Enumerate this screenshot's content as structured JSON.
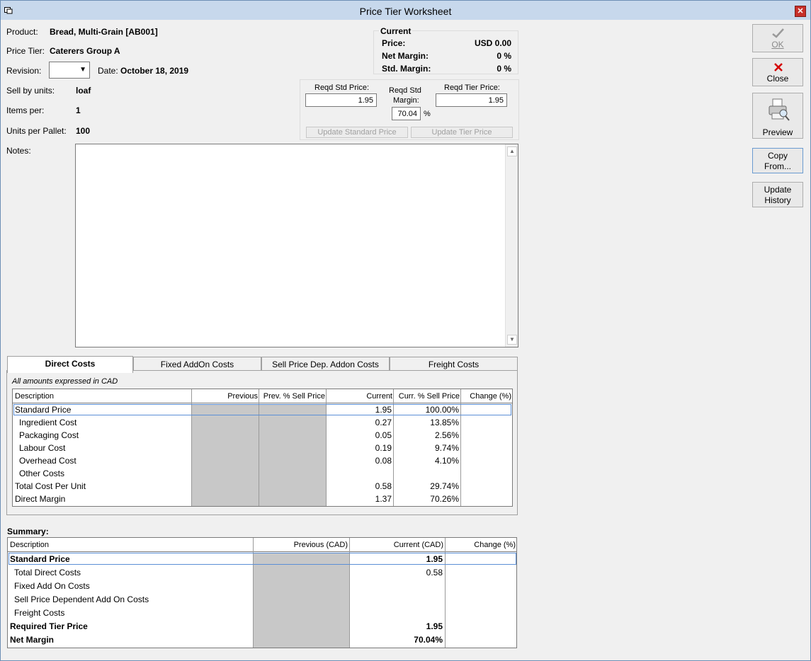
{
  "window": {
    "title": "Price Tier Worksheet",
    "close_glyph": "✕"
  },
  "product": {
    "product_label": "Product:",
    "product_value": "Bread, Multi-Grain [AB001]",
    "tier_label": "Price Tier:",
    "tier_value": "Caterers Group A",
    "revision_label": "Revision:",
    "revision_value": "",
    "date_label": "Date:",
    "date_value": "October 18, 2019",
    "sell_units_label": "Sell by units:",
    "sell_units_value": "loaf",
    "items_per_label": "Items per:",
    "items_per_value": "1",
    "units_pallet_label": "Units per Pallet:",
    "units_pallet_value": "100",
    "notes_label": "Notes:",
    "notes_value": ""
  },
  "current": {
    "title": "Current",
    "price_label": "Price:",
    "price_value": "USD 0.00",
    "net_margin_label": "Net Margin:",
    "net_margin_value": "0 %",
    "std_margin_label": "Std. Margin:",
    "std_margin_value": "0 %"
  },
  "required": {
    "std_price_label": "Reqd Std Price:",
    "std_price_value": "1.95",
    "std_margin_label_1": "Reqd Std",
    "std_margin_label_2": "Margin:",
    "std_margin_value": "70.04",
    "percent": "%",
    "tier_price_label": "Reqd Tier Price:",
    "tier_price_value": "1.95",
    "update_std_btn": "Update Standard Price",
    "update_tier_btn": "Update Tier Price"
  },
  "buttons": {
    "ok": "OK",
    "close": "Close",
    "preview": "Preview",
    "copy_1": "Copy",
    "copy_2": "From...",
    "history_1": "Update",
    "history_2": "History"
  },
  "tabs": [
    "Direct Costs",
    "Fixed AddOn Costs",
    "Sell Price Dep. Addon Costs",
    "Freight Costs"
  ],
  "direct_costs": {
    "note": "All amounts expressed in CAD",
    "headers": [
      "Description",
      "Previous",
      "Prev. % Sell Price",
      "Current",
      "Curr. % Sell Price",
      "Change (%)"
    ],
    "rows": [
      [
        "Standard Price",
        "",
        "",
        "1.95",
        "100.00%",
        ""
      ],
      [
        "Ingredient Cost",
        "",
        "",
        "0.27",
        "13.85%",
        ""
      ],
      [
        "Packaging Cost",
        "",
        "",
        "0.05",
        "2.56%",
        ""
      ],
      [
        "Labour Cost",
        "",
        "",
        "0.19",
        "9.74%",
        ""
      ],
      [
        "Overhead Cost",
        "",
        "",
        "0.08",
        "4.10%",
        ""
      ],
      [
        "Other Costs",
        "",
        "",
        "",
        "",
        ""
      ],
      [
        "Total Cost Per Unit",
        "",
        "",
        "0.58",
        "29.74%",
        ""
      ],
      [
        "Direct Margin",
        "",
        "",
        "1.37",
        "70.26%",
        ""
      ]
    ]
  },
  "summary": {
    "title": "Summary:",
    "headers": [
      "Description",
      "Previous (CAD)",
      "Current (CAD)",
      "Change (%)"
    ],
    "rows": [
      [
        "Standard Price",
        "",
        "1.95",
        ""
      ],
      [
        "Total Direct Costs",
        "",
        "0.58",
        ""
      ],
      [
        "Fixed Add On Costs",
        "",
        "",
        ""
      ],
      [
        "Sell Price Dependent Add On Costs",
        "",
        "",
        ""
      ],
      [
        "Freight Costs",
        "",
        "",
        ""
      ],
      [
        "Required Tier Price",
        "",
        "1.95",
        ""
      ],
      [
        "Net Margin",
        "",
        "70.04%",
        ""
      ]
    ]
  }
}
